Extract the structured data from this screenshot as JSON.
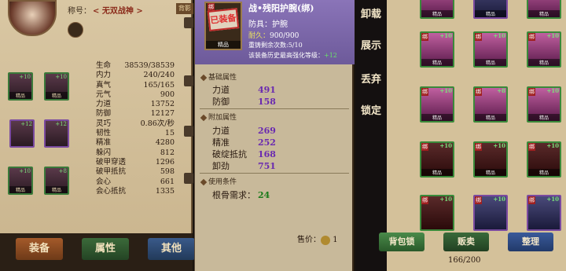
{
  "character": {
    "title_label": "称号：",
    "title_value": "< 无双战神 >",
    "tag_button": "背影",
    "stats": [
      {
        "label": "生命",
        "value": "38539/38539"
      },
      {
        "label": "内力",
        "value": "240/240"
      },
      {
        "label": "真气",
        "value": "165/165"
      },
      {
        "label": "元气",
        "value": "900"
      },
      {
        "label": "力道",
        "value": "13752"
      },
      {
        "label": "防御",
        "value": "12127"
      },
      {
        "label": "灵巧",
        "value": "0.86次/秒"
      },
      {
        "label": "韧性",
        "value": "15"
      },
      {
        "label": "精准",
        "value": "4280"
      },
      {
        "label": "躲闪",
        "value": "812"
      },
      {
        "label": "破甲穿透",
        "value": "1296"
      },
      {
        "label": "破甲抵抗",
        "value": "598"
      },
      {
        "label": "会心",
        "value": "661"
      },
      {
        "label": "会心抵抗",
        "value": "1335"
      }
    ],
    "equip_slots": [
      {
        "level": "+10",
        "quality": "精品"
      },
      {
        "level": "+10",
        "quality": "精品"
      },
      {
        "level": "+12",
        "quality": ""
      },
      {
        "level": "+12",
        "quality": ""
      },
      {
        "level": "+10",
        "quality": "精品"
      },
      {
        "level": "+8",
        "quality": "精品"
      }
    ]
  },
  "tabs": {
    "equipment": "装备",
    "attributes": "属性",
    "other": "其他"
  },
  "tooltip": {
    "item_name": "战•残阳护腕(绑)",
    "stamp": "已装备",
    "binding": "绑",
    "quality": "精品",
    "type_line": "防具：护腕",
    "durability_label": "耐久：",
    "durability_value": "900/900",
    "forge_line": "重铸剩余次数:5/10",
    "history_line": "该装备历史最高强化等级：",
    "history_value": "+12",
    "base_section": "基础属性",
    "base_attrs": [
      {
        "name": "力道",
        "value": "491"
      },
      {
        "name": "防御",
        "value": "158"
      }
    ],
    "extra_section": "附加属性",
    "extra_attrs": [
      {
        "name": "力道",
        "value": "269"
      },
      {
        "name": "精准",
        "value": "252"
      },
      {
        "name": "破绽抵抗",
        "value": "168"
      },
      {
        "name": "卸劲",
        "value": "751"
      }
    ],
    "req_section": "使用条件",
    "requirement_name": "根骨需求：",
    "requirement_value": "24",
    "price_label": "售价：",
    "price_value": "1"
  },
  "actions": {
    "unequip": "卸载",
    "display": "展示",
    "discard": "丢弃",
    "lock": "锁定"
  },
  "inventory": {
    "slot_rows": [
      [
        "+10",
        "+10",
        "+10"
      ],
      [
        "+10",
        "+8",
        "+10"
      ],
      [
        "+10",
        "+10",
        "+10"
      ],
      [
        "+10",
        "+10",
        "+10"
      ],
      [
        "+10",
        "+10",
        "+10"
      ]
    ],
    "binding": "绑",
    "quality": "精品",
    "lock_button": "背包锁",
    "sell_button": "贩卖",
    "sort_button": "整理",
    "capacity": "166/200"
  },
  "colors": {
    "bind_red": "#a02020",
    "level_green": "#7ae07a",
    "attr_purple": "#6a2ab0",
    "attr_green": "#1a7a1a",
    "tooltip_header": "#8a74b8"
  }
}
